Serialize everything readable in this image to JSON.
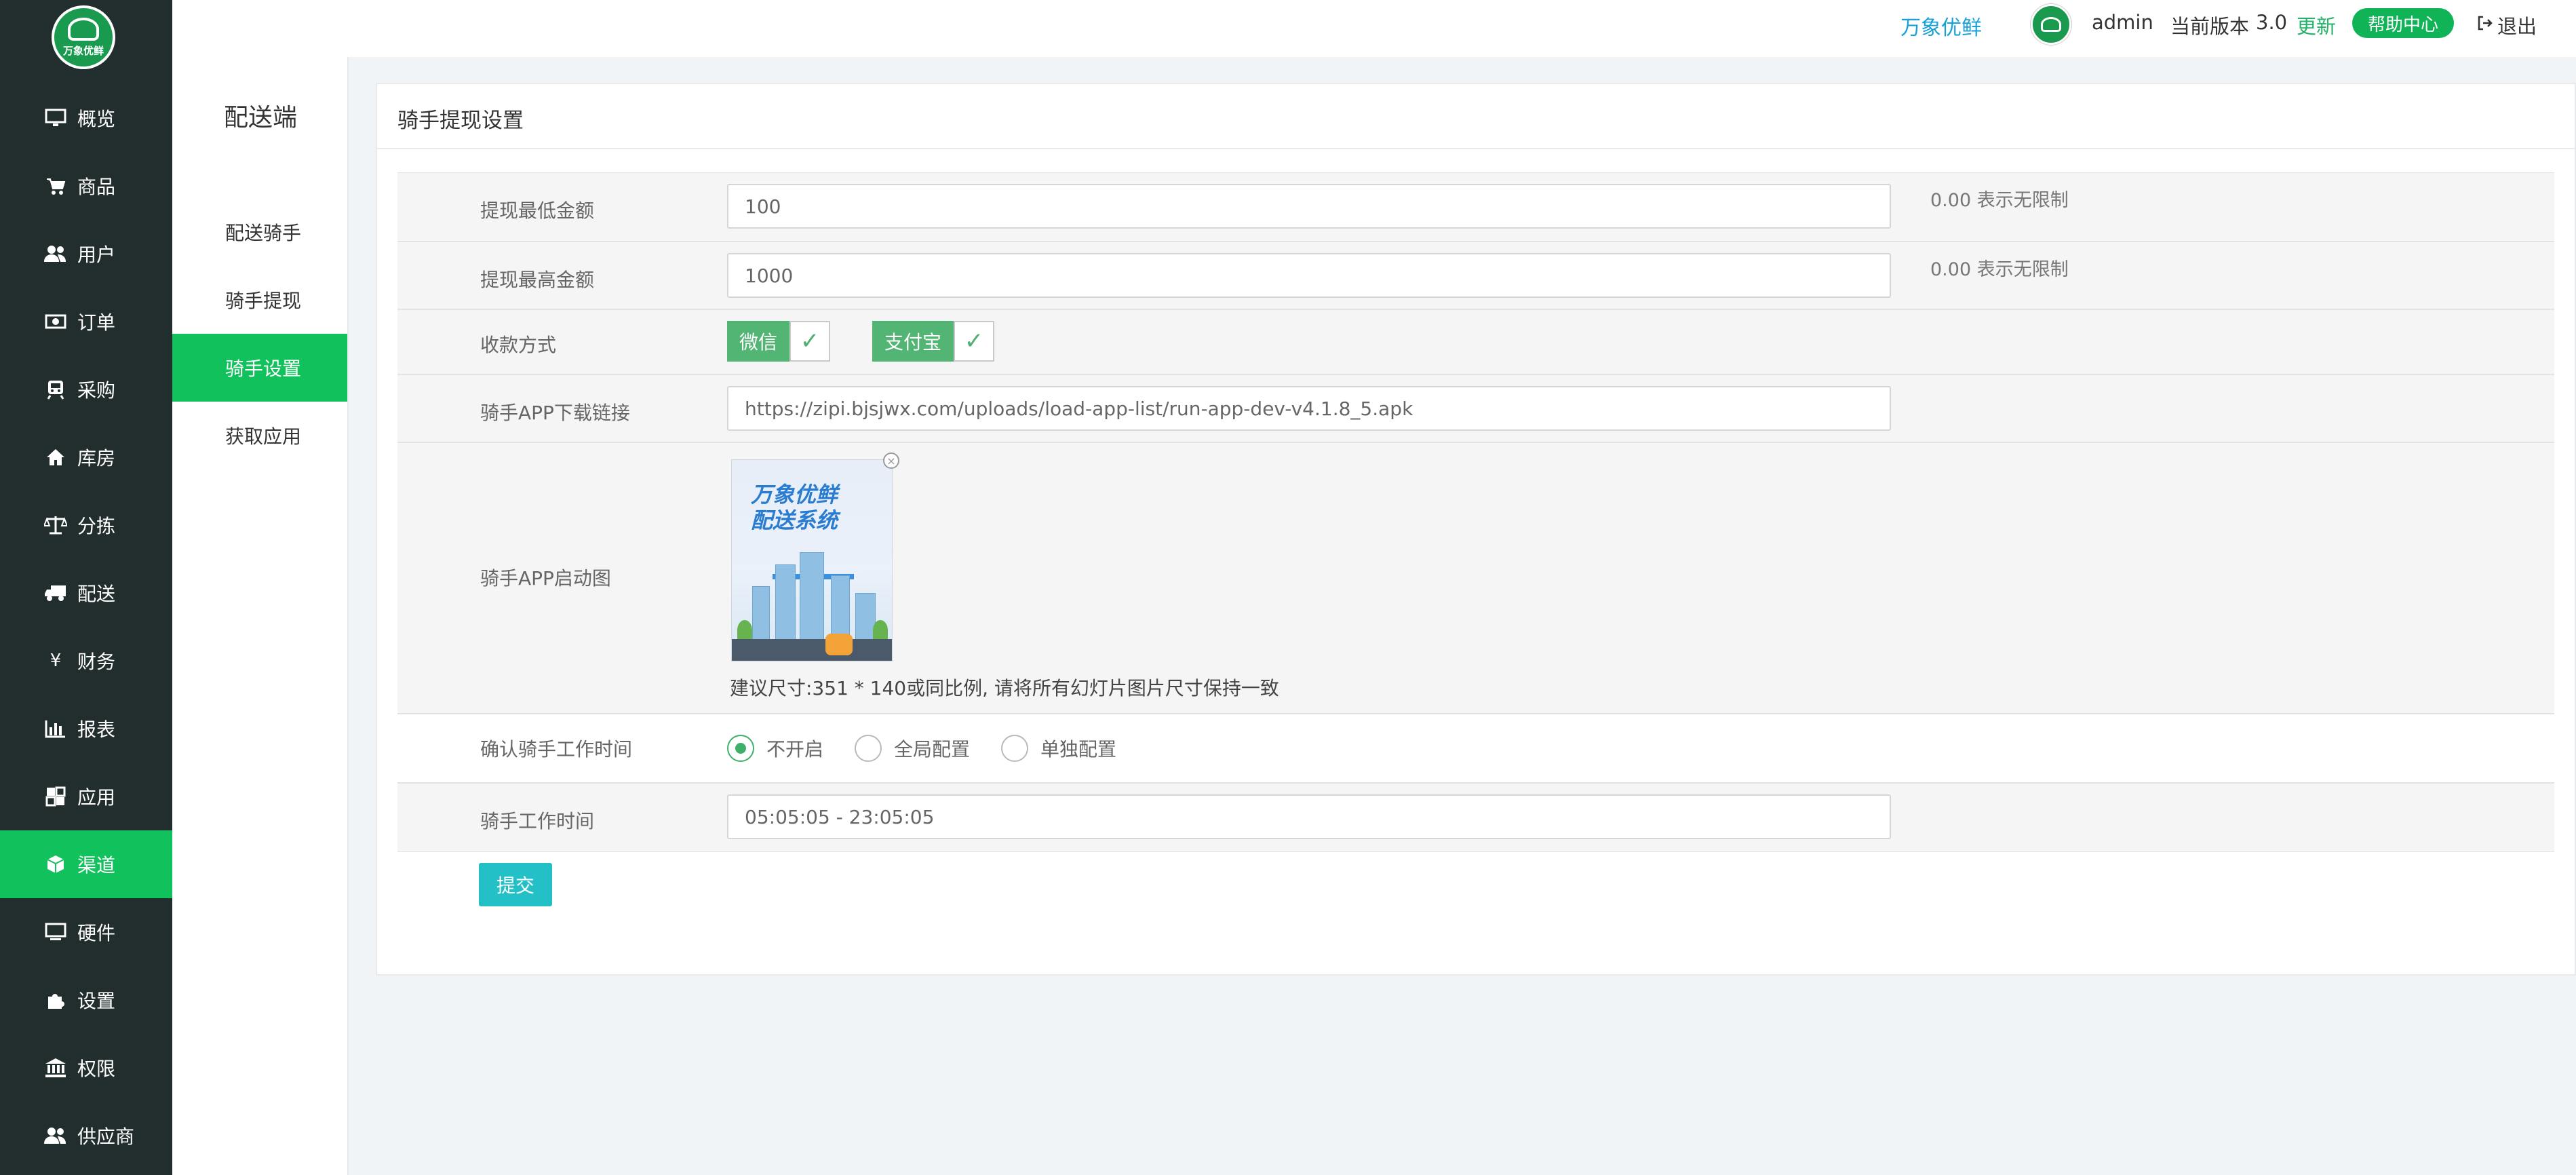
{
  "header": {
    "brand": "万象优鲜",
    "username": "admin",
    "version_label": "当前版本",
    "version_number": "3.0",
    "update_label": "更新",
    "help_label": "帮助中心",
    "logout_label": "退出"
  },
  "logo": {
    "text": "万象优鲜"
  },
  "sidebar": {
    "items": [
      {
        "label": "概览",
        "icon": "monitor-icon"
      },
      {
        "label": "商品",
        "icon": "cart-icon"
      },
      {
        "label": "用户",
        "icon": "users-icon"
      },
      {
        "label": "订单",
        "icon": "money-icon"
      },
      {
        "label": "采购",
        "icon": "train-icon"
      },
      {
        "label": "库房",
        "icon": "home-icon"
      },
      {
        "label": "分拣",
        "icon": "scale-icon"
      },
      {
        "label": "配送",
        "icon": "truck-icon"
      },
      {
        "label": "财务",
        "icon": "yen-icon"
      },
      {
        "label": "报表",
        "icon": "bar-chart-icon"
      },
      {
        "label": "应用",
        "icon": "apps-icon"
      },
      {
        "label": "渠道",
        "icon": "cube-icon",
        "active": true
      },
      {
        "label": "硬件",
        "icon": "desktop-icon"
      },
      {
        "label": "设置",
        "icon": "puzzle-icon"
      },
      {
        "label": "权限",
        "icon": "bank-icon"
      },
      {
        "label": "供应商",
        "icon": "users-icon"
      }
    ]
  },
  "subnav": {
    "title": "配送端",
    "items": [
      {
        "label": "配送骑手"
      },
      {
        "label": "骑手提现"
      },
      {
        "label": "骑手设置",
        "active": true
      },
      {
        "label": "获取应用"
      }
    ]
  },
  "panel": {
    "title": "骑手提现设置"
  },
  "form": {
    "min_withdraw": {
      "label": "提现最低金额",
      "value": "100",
      "hint": "0.00 表示无限制"
    },
    "max_withdraw": {
      "label": "提现最高金额",
      "value": "1000",
      "hint": "0.00 表示无限制"
    },
    "payment": {
      "label": "收款方式",
      "options": [
        {
          "label": "微信",
          "checked": true
        },
        {
          "label": "支付宝",
          "checked": true
        }
      ]
    },
    "app_link": {
      "label": "骑手APP下载链接",
      "value": "https://zipi.bjsjwx.com/uploads/load-app-list/run-app-dev-v4.1.8_5.apk"
    },
    "splash": {
      "label": "骑手APP启动图",
      "image_text_line1": "万象优鲜",
      "image_text_line2": "配送系统",
      "size_hint": "建议尺寸:351 * 140或同比例, 请将所有幻灯片图片尺寸保持一致"
    },
    "confirm_work_time": {
      "label": "确认骑手工作时间",
      "options": [
        {
          "label": "不开启",
          "checked": true
        },
        {
          "label": "全局配置",
          "checked": false
        },
        {
          "label": "单独配置",
          "checked": false
        }
      ]
    },
    "work_time": {
      "label": "骑手工作时间",
      "value": "05:05:05 - 23:05:05"
    },
    "submit_label": "提交"
  },
  "colors": {
    "sidebar_bg": "#222d2e",
    "accent_green": "#11c25c",
    "submit": "#23c0c8",
    "brand_link": "#16a1d9"
  }
}
